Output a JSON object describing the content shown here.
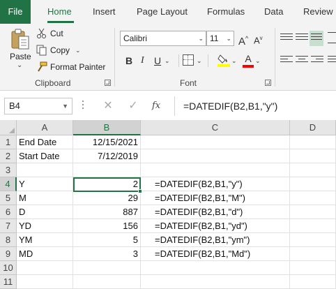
{
  "ribbon": {
    "tabs": [
      "File",
      "Home",
      "Insert",
      "Page Layout",
      "Formulas",
      "Data",
      "Review"
    ],
    "active_tab": "Home",
    "clipboard": {
      "paste_label": "Paste",
      "cut_label": "Cut",
      "copy_label": "Copy",
      "format_painter_label": "Format Painter",
      "group_label": "Clipboard"
    },
    "font": {
      "font_name": "Calibri",
      "font_size": "11",
      "grow_label": "A",
      "shrink_label": "A",
      "bold_label": "B",
      "italic_label": "I",
      "underline_label": "U",
      "font_color_label": "A",
      "group_label": "Font"
    },
    "colors": {
      "accent": "#217346",
      "highlight": "#ffff00",
      "font_color": "#ff0000"
    }
  },
  "formula_bar": {
    "name_box": "B4",
    "fx_label": "fx",
    "formula": "=DATEDIF(B2,B1,\"y\")"
  },
  "sheet": {
    "columns": [
      "A",
      "B",
      "C",
      "D"
    ],
    "rows": [
      "1",
      "2",
      "3",
      "4",
      "5",
      "6",
      "7",
      "8",
      "9",
      "10",
      "11"
    ],
    "selected_cell": "B4",
    "cells": {
      "A1": "End Date",
      "B1": "12/15/2021",
      "A2": "Start Date",
      "B2": "7/12/2019",
      "A4": "Y",
      "B4": "2",
      "C4": "=DATEDIF(B2,B1,\"y\")",
      "A5": "M",
      "B5": "29",
      "C5": "=DATEDIF(B2,B1,\"M\")",
      "A6": "D",
      "B6": "887",
      "C6": "=DATEDIF(B2,B1,\"d\")",
      "A7": "YD",
      "B7": "156",
      "C7": "=DATEDIF(B2,B1,\"yd\")",
      "A8": "YM",
      "B8": "5",
      "C8": "=DATEDIF(B2,B1,\"ym\")",
      "A9": "MD",
      "B9": "3",
      "C9": "=DATEDIF(B2,B1,\"Md\")"
    }
  }
}
